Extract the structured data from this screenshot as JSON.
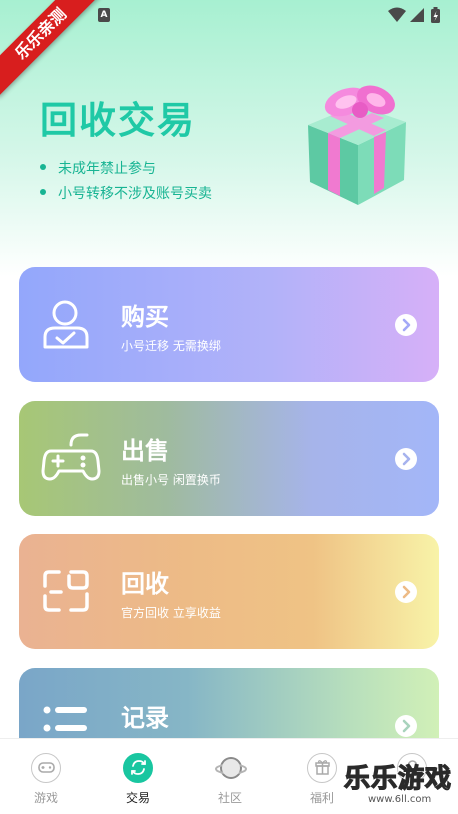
{
  "status_bar": {
    "notification_letter": "A",
    "icons": [
      "wifi-icon",
      "signal-icon",
      "battery-icon"
    ]
  },
  "watermark_ribbon": "乐乐亲测",
  "header": {
    "title": "回收交易",
    "notices": [
      "未成年禁止参与",
      "小号转移不涉及账号买卖"
    ]
  },
  "cards": [
    {
      "title": "购买",
      "subtitle": "小号迁移 无需换绑",
      "icon": "user-icon"
    },
    {
      "title": "出售",
      "subtitle": "出售小号 闲置换币",
      "icon": "gamepad-icon"
    },
    {
      "title": "回收",
      "subtitle": "官方回收 立享收益",
      "icon": "recycle-icon"
    },
    {
      "title": "记录",
      "subtitle": "",
      "icon": "list-icon"
    }
  ],
  "bottom_nav": {
    "items": [
      {
        "label": "游戏",
        "icon": "game-icon"
      },
      {
        "label": "交易",
        "icon": "trade-icon",
        "active": true
      },
      {
        "label": "社区",
        "icon": "planet-icon"
      },
      {
        "label": "福利",
        "icon": "gift-icon"
      },
      {
        "label": "",
        "icon": "profile-icon"
      }
    ]
  },
  "watermark": {
    "text": "乐乐游戏",
    "url": "www.6ll.com"
  },
  "colors": {
    "accent": "#1fc9a6",
    "buy_card": "#93a7fb",
    "sell_card": "#a7c775",
    "recycle_card": "#edbb86",
    "record_card": "#7aa6c8"
  }
}
